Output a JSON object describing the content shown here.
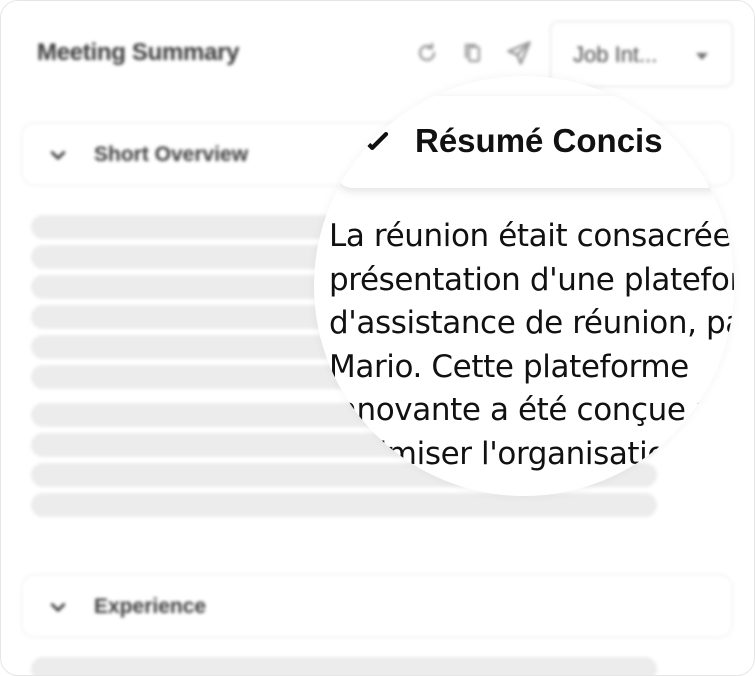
{
  "header": {
    "title": "Meeting Summary",
    "icons": [
      "refresh-icon",
      "copy-icon",
      "send-icon"
    ],
    "template_select": {
      "value": "Job Int..."
    }
  },
  "sections": [
    {
      "label": "Short Overview",
      "icon": "chevron-down-icon",
      "loading_bars": 10
    },
    {
      "label": "Experience",
      "icon": "chevron-down-icon"
    }
  ],
  "magnifier": {
    "title": "Résumé Concis",
    "check_icon": "check-icon",
    "text": "La réunion était consacrée à la présentation d'une plateforme d'assistance de réunion, par Mario. Cette plateforme innovante a été conçue pour optimiser l'organisation"
  }
}
